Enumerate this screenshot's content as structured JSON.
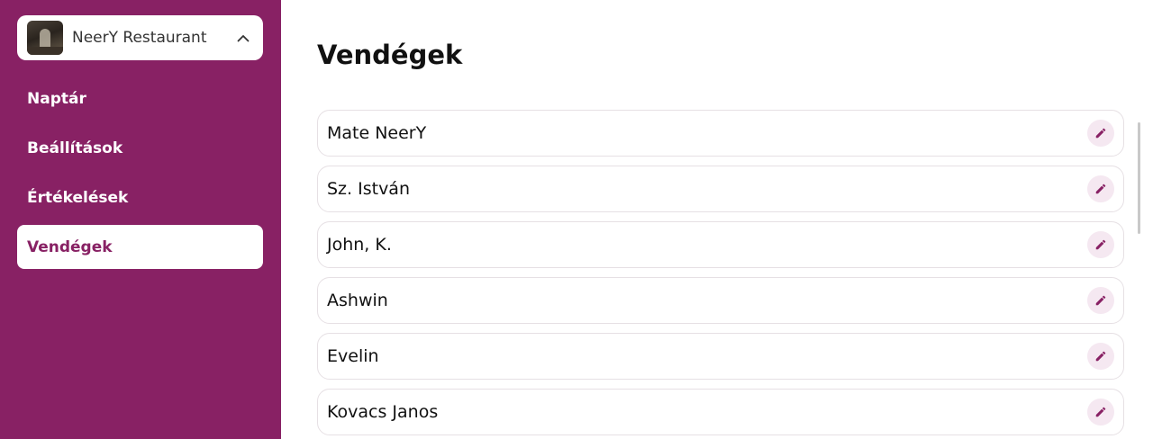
{
  "sidebar": {
    "restaurant_name": "NeerY Restaurant",
    "nav_items": [
      {
        "label": "Naptár"
      },
      {
        "label": "Beállítások"
      },
      {
        "label": "Értékelések"
      },
      {
        "label": "Vendégek",
        "active": true
      }
    ]
  },
  "main": {
    "title": "Vendégek",
    "guests": [
      {
        "name": "Mate NeerY"
      },
      {
        "name": "Sz. István"
      },
      {
        "name": "John, K."
      },
      {
        "name": "Ashwin"
      },
      {
        "name": "Evelin"
      },
      {
        "name": "Kovacs Janos"
      }
    ]
  },
  "colors": {
    "brand": "#882164",
    "edit_button_bg": "#f5e8f1"
  },
  "icons": {
    "switcher": "chevron-up-icon",
    "edit": "pencil-icon"
  }
}
